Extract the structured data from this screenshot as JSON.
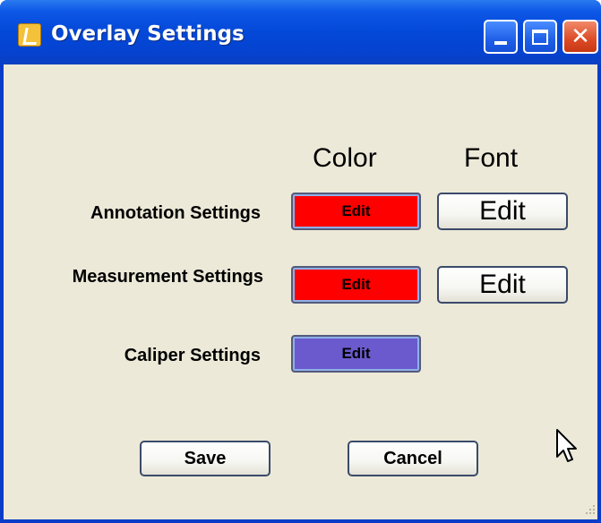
{
  "window": {
    "title": "Overlay Settings"
  },
  "headers": {
    "color": "Color",
    "font": "Font"
  },
  "rows": [
    {
      "label": "Annotation Settings",
      "color_button": "Edit",
      "color_swatch": "#ff0000",
      "font_button": "Edit"
    },
    {
      "label": "Measurement Settings",
      "color_button": "Edit",
      "color_swatch": "#ff0000",
      "font_button": "Edit"
    },
    {
      "label": "Caliper Settings",
      "color_button": "Edit",
      "color_swatch": "#6a5acd"
    }
  ],
  "actions": {
    "save": "Save",
    "cancel": "Cancel"
  },
  "icons": {
    "app": "app-icon",
    "minimize": "minimize-icon",
    "maximize": "maximize-icon",
    "close": "close-icon",
    "cursor": "mouse-pointer-icon"
  }
}
